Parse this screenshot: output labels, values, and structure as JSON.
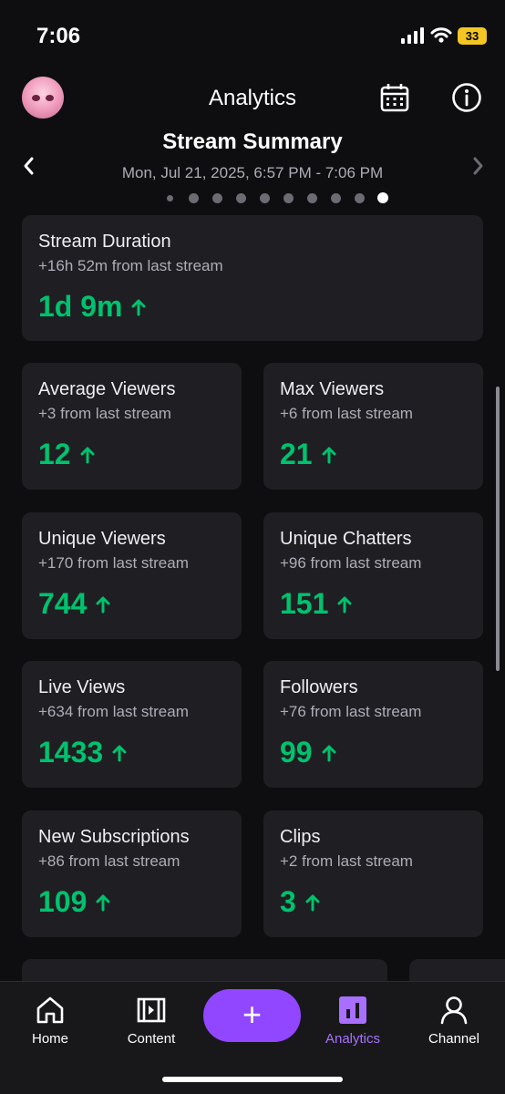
{
  "status": {
    "time": "7:06",
    "battery": "33"
  },
  "header": {
    "title": "Analytics"
  },
  "summary": {
    "title": "Stream Summary",
    "date": "Mon, Jul 21, 2025, 6:57 PM - 7:06 PM",
    "pages": 10,
    "active_page": 9
  },
  "cards": [
    {
      "title": "Stream Duration",
      "sub": "+16h 52m from last stream",
      "value": "1d 9m"
    },
    {
      "title": "Average Viewers",
      "sub": "+3 from last stream",
      "value": "12"
    },
    {
      "title": "Max Viewers",
      "sub": "+6 from last stream",
      "value": "21"
    },
    {
      "title": "Unique Viewers",
      "sub": "+170 from last stream",
      "value": "744"
    },
    {
      "title": "Unique Chatters",
      "sub": "+96 from last stream",
      "value": "151"
    },
    {
      "title": "Live Views",
      "sub": "+634 from last stream",
      "value": "1433"
    },
    {
      "title": "Followers",
      "sub": "+76 from last stream",
      "value": "99"
    },
    {
      "title": "New Subscriptions",
      "sub": "+86 from last stream",
      "value": "109"
    },
    {
      "title": "Clips",
      "sub": "+2 from last stream",
      "value": "3"
    }
  ],
  "tabs": [
    {
      "label": "Home",
      "icon": "home-icon"
    },
    {
      "label": "Content",
      "icon": "film-icon"
    },
    {
      "label": "Analytics",
      "icon": "bar-chart-icon"
    },
    {
      "label": "Channel",
      "icon": "user-icon"
    }
  ],
  "create": {
    "label": "+"
  },
  "colors": {
    "accent": "#9147ff",
    "positive": "#00c26e",
    "card": "#1f1f23",
    "background": "#0e0e10"
  }
}
